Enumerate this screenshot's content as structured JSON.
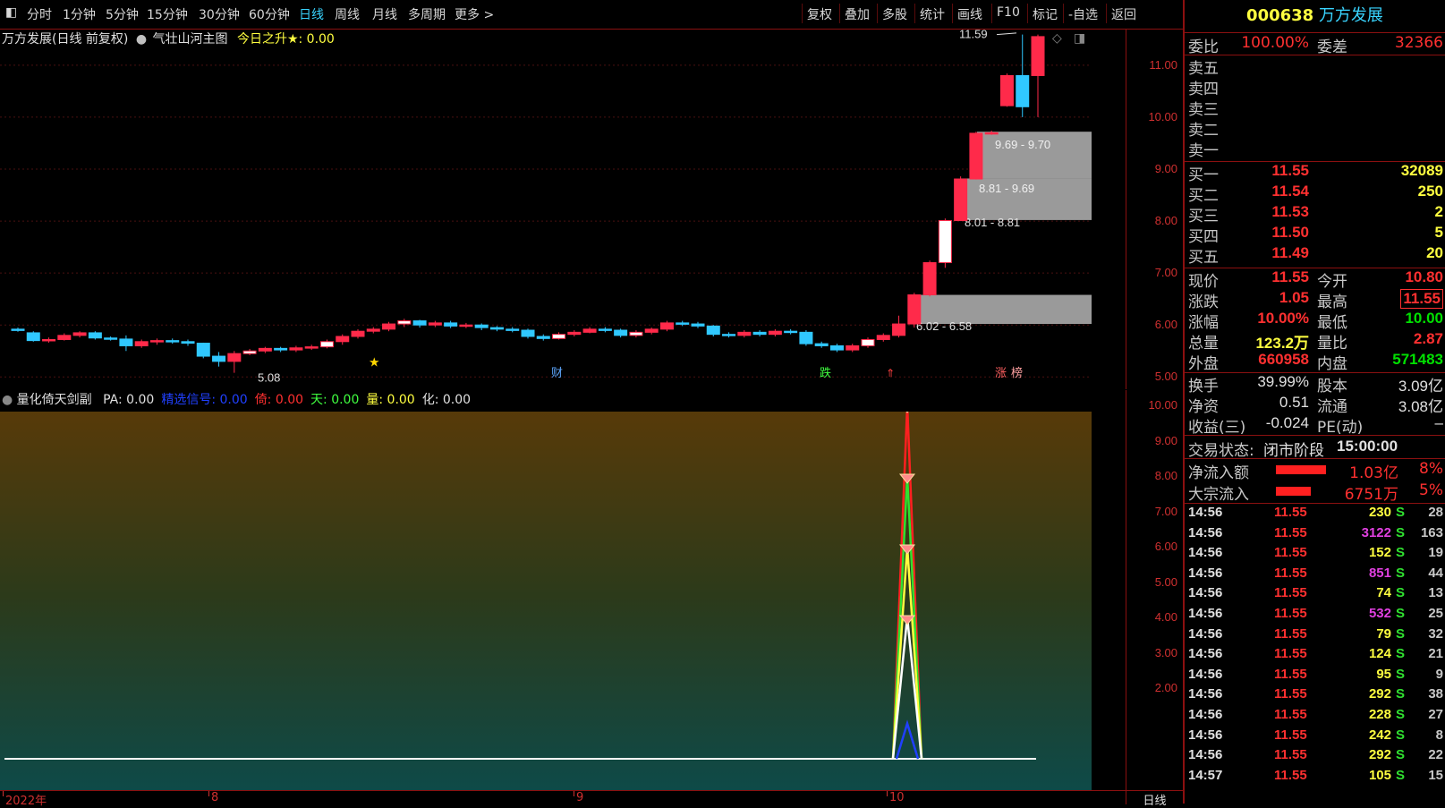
{
  "toolbar": {
    "left_items": [
      "分时",
      "1分钟",
      "5分钟",
      "15分钟",
      "30分钟",
      "60分钟",
      "日线",
      "周线",
      "月线",
      "多周期",
      "更多 >"
    ],
    "active": "日线",
    "right_items": [
      "复权",
      "叠加",
      "多股",
      "统计",
      "画线",
      "F10",
      "标记",
      "-自选",
      "返回"
    ]
  },
  "main_chart": {
    "title": "万方发展(日线 前复权)",
    "indicator_name": "气壮山河主图",
    "indicator_value": "今日之升★: 0.00",
    "y_ticks": [
      "11.00",
      "10.00",
      "9.00",
      "8.00",
      "7.00",
      "6.00",
      "5.00"
    ],
    "zones": [
      "9.69 - 9.70",
      "8.81 - 9.69",
      "8.01 - 8.81",
      "6.02 - 6.58"
    ],
    "high_label": "11.59",
    "low_label": "5.08",
    "markers": [
      "财",
      "跌",
      "涨",
      "榜"
    ]
  },
  "sub_chart": {
    "name": "量化倚天剑副",
    "values": [
      {
        "label": "PA: 0.00",
        "color": "#e0e0e0"
      },
      {
        "label": "精选信号: 0.00",
        "color": "#2040ff"
      },
      {
        "label": "倚: 0.00",
        "color": "#ff3030"
      },
      {
        "label": "天: 0.00",
        "color": "#40ff40"
      },
      {
        "label": "量: 0.00",
        "color": "#ffff40"
      },
      {
        "label": "化: 0.00",
        "color": "#e0e0e0"
      }
    ],
    "y_ticks": [
      "10.00",
      "9.00",
      "8.00",
      "7.00",
      "6.00",
      "5.00",
      "4.00",
      "3.00",
      "2.00"
    ]
  },
  "x_axis": {
    "labels": [
      "2022年",
      "8",
      "9",
      "10"
    ],
    "period": "日线"
  },
  "quote": {
    "code": "000638",
    "name": "万方发展",
    "weibi_label": "委比",
    "weibi": "100.00%",
    "weicha_label": "委差",
    "weicha": "32366",
    "sells": [
      "卖五",
      "卖四",
      "卖三",
      "卖二",
      "卖一"
    ],
    "buys": [
      {
        "label": "买一",
        "price": "11.55",
        "vol": "32089"
      },
      {
        "label": "买二",
        "price": "11.54",
        "vol": "250"
      },
      {
        "label": "买三",
        "price": "11.53",
        "vol": "2"
      },
      {
        "label": "买四",
        "price": "11.50",
        "vol": "5"
      },
      {
        "label": "买五",
        "price": "11.49",
        "vol": "20"
      }
    ],
    "stats": [
      {
        "l1": "现价",
        "v1": "11.55",
        "c1": "red",
        "l2": "今开",
        "v2": "10.80",
        "c2": "red"
      },
      {
        "l1": "涨跌",
        "v1": "1.05",
        "c1": "red",
        "l2": "最高",
        "v2": "11.55",
        "c2": "red"
      },
      {
        "l1": "涨幅",
        "v1": "10.00%",
        "c1": "red",
        "l2": "最低",
        "v2": "10.00",
        "c2": "green"
      },
      {
        "l1": "总量",
        "v1": "123.2万",
        "c1": "yellow",
        "l2": "量比",
        "v2": "2.87",
        "c2": "red"
      },
      {
        "l1": "外盘",
        "v1": "660958",
        "c1": "red",
        "l2": "内盘",
        "v2": "571483",
        "c2": "green"
      }
    ],
    "stats2": [
      {
        "l1": "换手",
        "v1": "39.99%",
        "l2": "股本",
        "v2": "3.09亿"
      },
      {
        "l1": "净资",
        "v1": "0.51",
        "l2": "流通",
        "v2": "3.08亿"
      },
      {
        "l1": "收益(三)",
        "v1": "-0.024",
        "l2": "PE(动)",
        "v2": "–"
      }
    ],
    "trade_status_label": "交易状态:",
    "trade_status": "闭市阶段",
    "trade_time": "15:00:00",
    "flows": [
      {
        "label": "净流入额",
        "value": "1.03亿",
        "pct": "8%",
        "fill": 0.8
      },
      {
        "label": "大宗流入",
        "value": "6751万",
        "pct": "5%",
        "fill": 0.55
      }
    ],
    "ticks": [
      {
        "time": "14:56",
        "price": "11.55",
        "vol": "230",
        "vcolor": "yellow",
        "side": "S",
        "n": "28"
      },
      {
        "time": "14:56",
        "price": "11.55",
        "vol": "3122",
        "vcolor": "magenta",
        "side": "S",
        "n": "163"
      },
      {
        "time": "14:56",
        "price": "11.55",
        "vol": "152",
        "vcolor": "yellow",
        "side": "S",
        "n": "19"
      },
      {
        "time": "14:56",
        "price": "11.55",
        "vol": "851",
        "vcolor": "magenta",
        "side": "S",
        "n": "44"
      },
      {
        "time": "14:56",
        "price": "11.55",
        "vol": "74",
        "vcolor": "yellow",
        "side": "S",
        "n": "13"
      },
      {
        "time": "14:56",
        "price": "11.55",
        "vol": "532",
        "vcolor": "magenta",
        "side": "S",
        "n": "25"
      },
      {
        "time": "14:56",
        "price": "11.55",
        "vol": "79",
        "vcolor": "yellow",
        "side": "S",
        "n": "32"
      },
      {
        "time": "14:56",
        "price": "11.55",
        "vol": "124",
        "vcolor": "yellow",
        "side": "S",
        "n": "21"
      },
      {
        "time": "14:56",
        "price": "11.55",
        "vol": "95",
        "vcolor": "yellow",
        "side": "S",
        "n": "9"
      },
      {
        "time": "14:56",
        "price": "11.55",
        "vol": "292",
        "vcolor": "yellow",
        "side": "S",
        "n": "38"
      },
      {
        "time": "14:56",
        "price": "11.55",
        "vol": "228",
        "vcolor": "yellow",
        "side": "S",
        "n": "27"
      },
      {
        "time": "14:56",
        "price": "11.55",
        "vol": "242",
        "vcolor": "yellow",
        "side": "S",
        "n": "8"
      },
      {
        "time": "14:56",
        "price": "11.55",
        "vol": "292",
        "vcolor": "yellow",
        "side": "S",
        "n": "22"
      },
      {
        "time": "14:57",
        "price": "11.55",
        "vol": "105",
        "vcolor": "yellow",
        "side": "S",
        "n": "15"
      }
    ]
  },
  "candles": [
    [
      5.92,
      5.9,
      5.95,
      5.87
    ],
    [
      5.85,
      5.7,
      5.88,
      5.68
    ],
    [
      5.7,
      5.72,
      5.76,
      5.66
    ],
    [
      5.72,
      5.8,
      5.84,
      5.7
    ],
    [
      5.8,
      5.85,
      5.88,
      5.76
    ],
    [
      5.85,
      5.75,
      5.88,
      5.72
    ],
    [
      5.75,
      5.73,
      5.78,
      5.7
    ],
    [
      5.73,
      5.6,
      5.8,
      5.5
    ],
    [
      5.6,
      5.68,
      5.72,
      5.56
    ],
    [
      5.68,
      5.7,
      5.74,
      5.62
    ],
    [
      5.7,
      5.68,
      5.74,
      5.64
    ],
    [
      5.68,
      5.65,
      5.72,
      5.6
    ],
    [
      5.65,
      5.4,
      5.66,
      5.36
    ],
    [
      5.4,
      5.3,
      5.48,
      5.2
    ],
    [
      5.3,
      5.45,
      5.5,
      5.08
    ],
    [
      5.45,
      5.5,
      5.54,
      5.42
    ],
    [
      5.5,
      5.55,
      5.58,
      5.46
    ],
    [
      5.55,
      5.52,
      5.58,
      5.48
    ],
    [
      5.52,
      5.56,
      5.6,
      5.48
    ],
    [
      5.56,
      5.58,
      5.62,
      5.52
    ],
    [
      5.58,
      5.68,
      5.72,
      5.55
    ],
    [
      5.68,
      5.78,
      5.82,
      5.62
    ],
    [
      5.78,
      5.88,
      5.92,
      5.74
    ],
    [
      5.88,
      5.92,
      5.96,
      5.84
    ],
    [
      5.92,
      6.02,
      6.06,
      5.88
    ],
    [
      6.02,
      6.08,
      6.12,
      5.96
    ],
    [
      6.08,
      6.0,
      6.1,
      5.95
    ],
    [
      6.0,
      6.04,
      6.08,
      5.96
    ],
    [
      6.04,
      5.98,
      6.08,
      5.94
    ],
    [
      5.98,
      6.0,
      6.04,
      5.94
    ],
    [
      6.0,
      5.95,
      6.03,
      5.9
    ],
    [
      5.95,
      5.92,
      5.98,
      5.88
    ],
    [
      5.92,
      5.9,
      5.96,
      5.86
    ],
    [
      5.9,
      5.78,
      5.93,
      5.74
    ],
    [
      5.78,
      5.74,
      5.82,
      5.7
    ],
    [
      5.74,
      5.82,
      5.86,
      5.72
    ],
    [
      5.82,
      5.86,
      5.9,
      5.78
    ],
    [
      5.86,
      5.92,
      5.96,
      5.84
    ],
    [
      5.92,
      5.9,
      5.96,
      5.86
    ],
    [
      5.9,
      5.8,
      5.93,
      5.76
    ],
    [
      5.8,
      5.86,
      5.9,
      5.76
    ],
    [
      5.86,
      5.92,
      5.95,
      5.82
    ],
    [
      5.92,
      6.04,
      6.08,
      5.88
    ],
    [
      6.04,
      6.02,
      6.08,
      5.98
    ],
    [
      6.02,
      5.98,
      6.06,
      5.94
    ],
    [
      5.98,
      5.82,
      6.0,
      5.78
    ],
    [
      5.82,
      5.8,
      5.86,
      5.76
    ],
    [
      5.8,
      5.86,
      5.9,
      5.76
    ],
    [
      5.86,
      5.82,
      5.9,
      5.78
    ],
    [
      5.82,
      5.88,
      5.92,
      5.78
    ],
    [
      5.88,
      5.86,
      5.92,
      5.82
    ],
    [
      5.86,
      5.64,
      5.9,
      5.6
    ],
    [
      5.64,
      5.6,
      5.68,
      5.56
    ],
    [
      5.6,
      5.52,
      5.64,
      5.48
    ],
    [
      5.52,
      5.6,
      5.64,
      5.48
    ],
    [
      5.6,
      5.72,
      5.76,
      5.56
    ],
    [
      5.72,
      5.8,
      5.84,
      5.68
    ],
    [
      5.8,
      6.02,
      6.18,
      5.76
    ],
    [
      6.02,
      6.58,
      6.62,
      5.95
    ],
    [
      6.58,
      7.2,
      7.24,
      6.55
    ],
    [
      7.2,
      8.01,
      8.05,
      7.1
    ],
    [
      8.01,
      8.81,
      8.86,
      8.0
    ],
    [
      8.81,
      9.69,
      9.72,
      8.8
    ],
    [
      9.69,
      9.7,
      9.74,
      9.66
    ],
    [
      10.22,
      10.8,
      10.84,
      10.2
    ],
    [
      10.8,
      10.2,
      11.59,
      10.0
    ],
    [
      10.8,
      11.55,
      11.59,
      10.0
    ]
  ],
  "colors": {
    "up": "#ff2a4a",
    "down": "#30c8ff",
    "grid": "#5a1212",
    "axis": "#d03030"
  }
}
